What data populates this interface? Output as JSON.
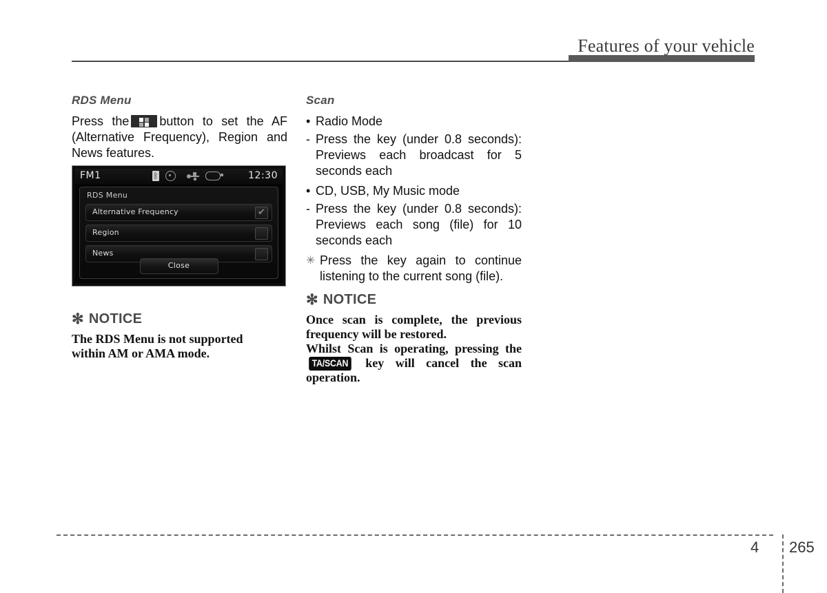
{
  "header": {
    "title": "Features of your vehicle"
  },
  "left_column": {
    "heading": "RDS Menu",
    "paragraph_before": "Press the",
    "button_icon": "grid-button-icon",
    "paragraph_after": "button to set the AF (Alternative Frequency), Region and News features.",
    "notice": {
      "star": "✻",
      "title": "NOTICE",
      "lines": [
        "The RDS Menu is not supported",
        "within AM or AMA mode."
      ]
    }
  },
  "lcd": {
    "status": {
      "source": "FM1",
      "clock": "12:30",
      "icons": [
        "bluetooth-icon",
        "disc-icon",
        "usb-icon",
        "aux-device-icon"
      ],
      "bluetooth_glyph": "ᛒ"
    },
    "panel_title": "RDS Menu",
    "rows": [
      {
        "label": "Alternative Frequency",
        "checked": true,
        "check_glyph": "✔"
      },
      {
        "label": "Region",
        "checked": false,
        "check_glyph": ""
      },
      {
        "label": "News",
        "checked": false,
        "check_glyph": ""
      }
    ],
    "close_label": "Close"
  },
  "right_column": {
    "heading": "Scan",
    "items": [
      {
        "mark": "•",
        "mark_kind": "dot",
        "text": "Radio Mode"
      },
      {
        "mark": "-",
        "mark_kind": "dash",
        "text": "Press the key (under 0.8 seconds): Previews each broadcast for 5 seconds each"
      },
      {
        "mark": "•",
        "mark_kind": "dot",
        "text": "CD, USB, My Music mode"
      },
      {
        "mark": "-",
        "mark_kind": "dash",
        "text": "Press the key (under 0.8 seconds): Previews each song (file) for 10 seconds each"
      },
      {
        "mark": "✳",
        "mark_kind": "star",
        "text": "Press the key again to continue listening to the current song (file)."
      }
    ],
    "notice": {
      "star": "✻",
      "title": "NOTICE",
      "para1": "Once scan is complete, the previous frequency will be restored.",
      "para2_before": "Whilst Scan is operating, pressing the",
      "key_badge": "TA/SCAN",
      "para2_after": "key will cancel the scan operation."
    }
  },
  "footer": {
    "chapter": "4",
    "page": "265"
  }
}
